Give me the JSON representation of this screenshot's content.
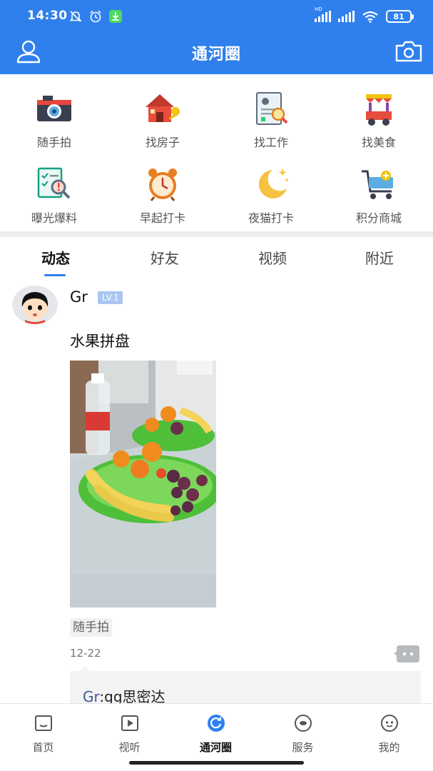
{
  "status_bar": {
    "time": "14:30",
    "battery": "81",
    "net_badge": "HD",
    "icons": [
      "mute-icon",
      "alarm-icon",
      "download-app-icon",
      "signal-icon",
      "signal-icon",
      "wifi-icon",
      "battery-icon"
    ]
  },
  "header": {
    "title": "通河圈",
    "left_icon": "user-icon",
    "right_icon": "camera-icon",
    "bg_color": "#2f80ed"
  },
  "grid": [
    {
      "label": "随手拍",
      "icon": "camera-icon"
    },
    {
      "label": "找房子",
      "icon": "house-key-icon"
    },
    {
      "label": "找工作",
      "icon": "resume-search-icon"
    },
    {
      "label": "找美食",
      "icon": "food-cart-icon"
    },
    {
      "label": "曝光爆料",
      "icon": "report-search-icon"
    },
    {
      "label": "早起打卡",
      "icon": "alarm-clock-icon"
    },
    {
      "label": "夜猫打卡",
      "icon": "moon-icon"
    },
    {
      "label": "积分商城",
      "icon": "shopping-cart-icon"
    }
  ],
  "tabs": [
    {
      "label": "动态",
      "active": true
    },
    {
      "label": "好友",
      "active": false
    },
    {
      "label": "视频",
      "active": false
    },
    {
      "label": "附近",
      "active": false
    }
  ],
  "post": {
    "username": "Gr",
    "level": "LV.1",
    "text": "水果拼盘",
    "tag": "随手拍",
    "date": "12-22",
    "comment": {
      "user": "Gr",
      "separator": ":",
      "text": "gg思密达"
    }
  },
  "bottom_nav": [
    {
      "label": "首页",
      "icon": "home-icon",
      "active": false
    },
    {
      "label": "视听",
      "icon": "play-icon",
      "active": false
    },
    {
      "label": "通河圈",
      "icon": "circle-refresh-icon",
      "active": true
    },
    {
      "label": "服务",
      "icon": "service-icon",
      "active": false
    },
    {
      "label": "我的",
      "icon": "profile-icon",
      "active": false
    }
  ]
}
